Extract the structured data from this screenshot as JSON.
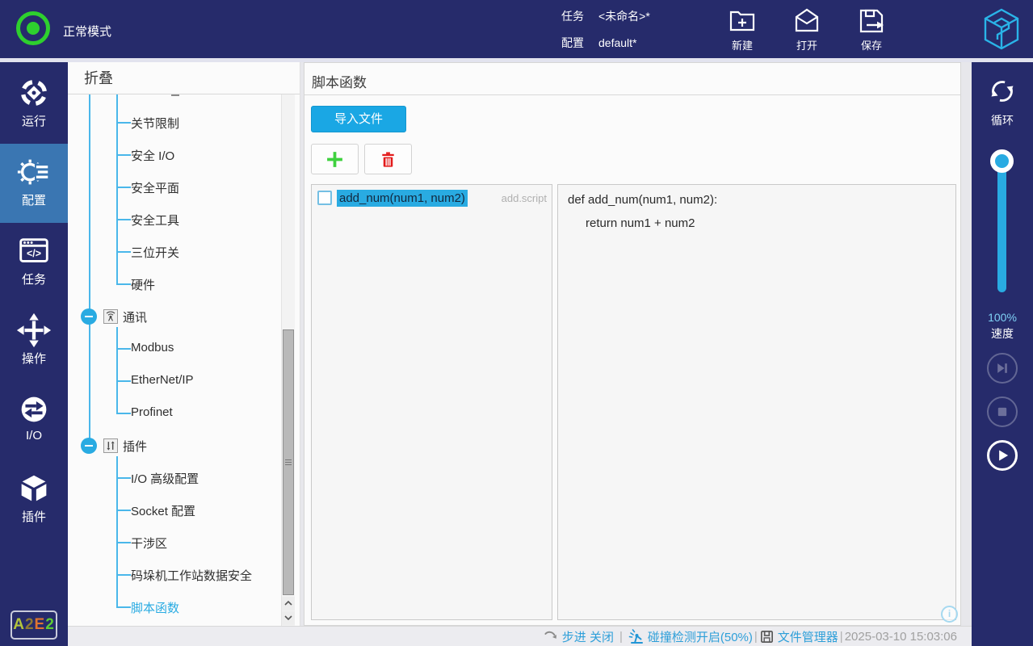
{
  "colors": {
    "navy": "#262b6b",
    "nav_active_blue": "#3a76b2",
    "accent_blue": "#29abe2",
    "status_green": "#2ed02e",
    "plus_green": "#3fd13f",
    "trash_red": "#e31b1b",
    "statusbar_blue": "#2e9fd9",
    "logo_cyan": "#2ab4e8"
  },
  "topbar": {
    "mode": "正常模式",
    "task_label": "任务",
    "task_value": "<未命名>*",
    "config_label": "配置",
    "config_value": "default*",
    "actions": [
      {
        "label": "新建"
      },
      {
        "label": "打开"
      },
      {
        "label": "保存"
      }
    ]
  },
  "nav": {
    "items": [
      {
        "label": "运行"
      },
      {
        "label": "配置"
      },
      {
        "label": "任务"
      },
      {
        "label": "操作"
      },
      {
        "label": "I/O"
      },
      {
        "label": "插件"
      }
    ],
    "badge": {
      "letters": [
        {
          "ch": "A",
          "color": "#b3c43c"
        },
        {
          "ch": "2",
          "color": "#8f7a33"
        },
        {
          "ch": "E",
          "color": "#e0742f"
        },
        {
          "ch": "2",
          "color": "#5ecb34"
        }
      ]
    }
  },
  "tree": {
    "header": "折叠",
    "items": [
      {
        "label": "关节限制"
      },
      {
        "label": "安全 I/O"
      },
      {
        "label": "安全平面"
      },
      {
        "label": "安全工具"
      },
      {
        "label": "三位开关"
      },
      {
        "label": "硬件"
      },
      {
        "label": "通讯"
      },
      {
        "label": "Modbus"
      },
      {
        "label": "EtherNet/IP"
      },
      {
        "label": "Profinet"
      },
      {
        "label": "插件"
      },
      {
        "label": "I/O 高级配置"
      },
      {
        "label": "Socket 配置"
      },
      {
        "label": "干涉区"
      },
      {
        "label": "码垛机工作站数据安全"
      },
      {
        "label": "脚本函数"
      }
    ]
  },
  "main": {
    "title": "脚本函数",
    "import_button": "导入文件",
    "list": {
      "item_label": "add_num(num1, num2)",
      "item_file": "add.script"
    },
    "code": {
      "lines": [
        "def add_num(num1, num2):",
        "return num1 + num2"
      ]
    }
  },
  "rightbar": {
    "loop_label": "循环",
    "speed_percent": "100%",
    "speed_label": "速度"
  },
  "statusbar": {
    "step": "步进 关闭",
    "collision": "碰撞检测开启(50%)",
    "file_manager": "文件管理器",
    "timestamp": "2025-03-10 15:03:06"
  }
}
